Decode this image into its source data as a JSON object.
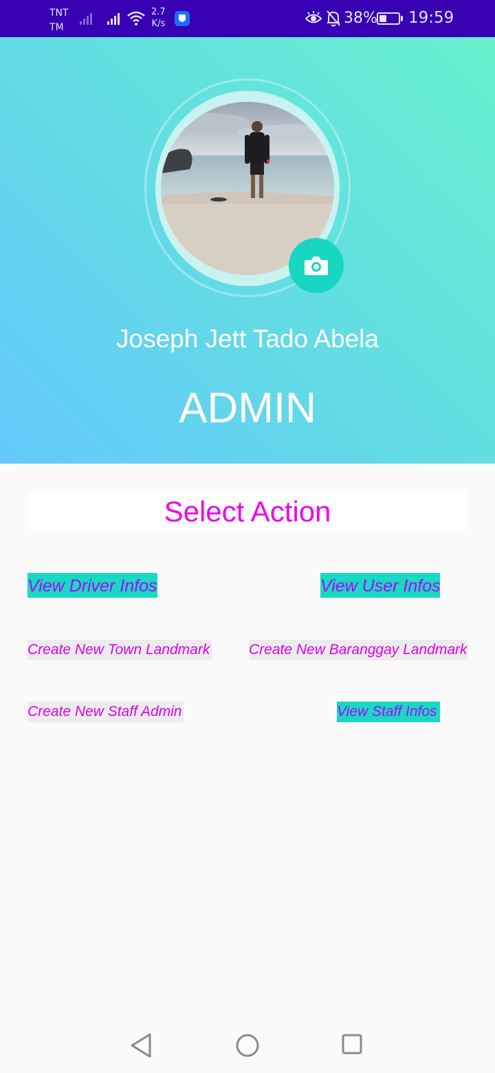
{
  "status_bar": {
    "carrier_line1": "TNT",
    "carrier_line2": "TM",
    "speed_value": "2.7",
    "speed_unit": "K/s",
    "battery": "38%",
    "battery_level": 0.38,
    "time": "19:59",
    "icons": [
      "signal-icon",
      "wifi-icon",
      "vpn-shield-icon",
      "eye-comfort-icon",
      "bell-off-icon",
      "battery-icon"
    ]
  },
  "profile": {
    "name": "Joseph Jett Tado Abela",
    "role": "ADMIN",
    "avatar_icon": "profile-photo",
    "camera_icon": "camera-icon"
  },
  "actions": {
    "title": "Select Action",
    "view_driver": "View Driver Infos",
    "view_user": "View User Infos",
    "create_town": "Create New Town Landmark",
    "create_barangay": "Create New Baranggay Landmark",
    "create_staff": "Create New Staff Admin",
    "view_staff": "View Staff Infos"
  },
  "colors": {
    "status_bar": "#3700b3",
    "header_gradient_start": "#67f0cd",
    "header_gradient_end": "#63c8fc",
    "accent_teal": "#18d9c3",
    "magenta_text": "#ee00ee",
    "purple_text": "#b400ff"
  },
  "nav_bar": {
    "icons": [
      "back-icon",
      "home-icon",
      "recent-apps-icon"
    ]
  }
}
